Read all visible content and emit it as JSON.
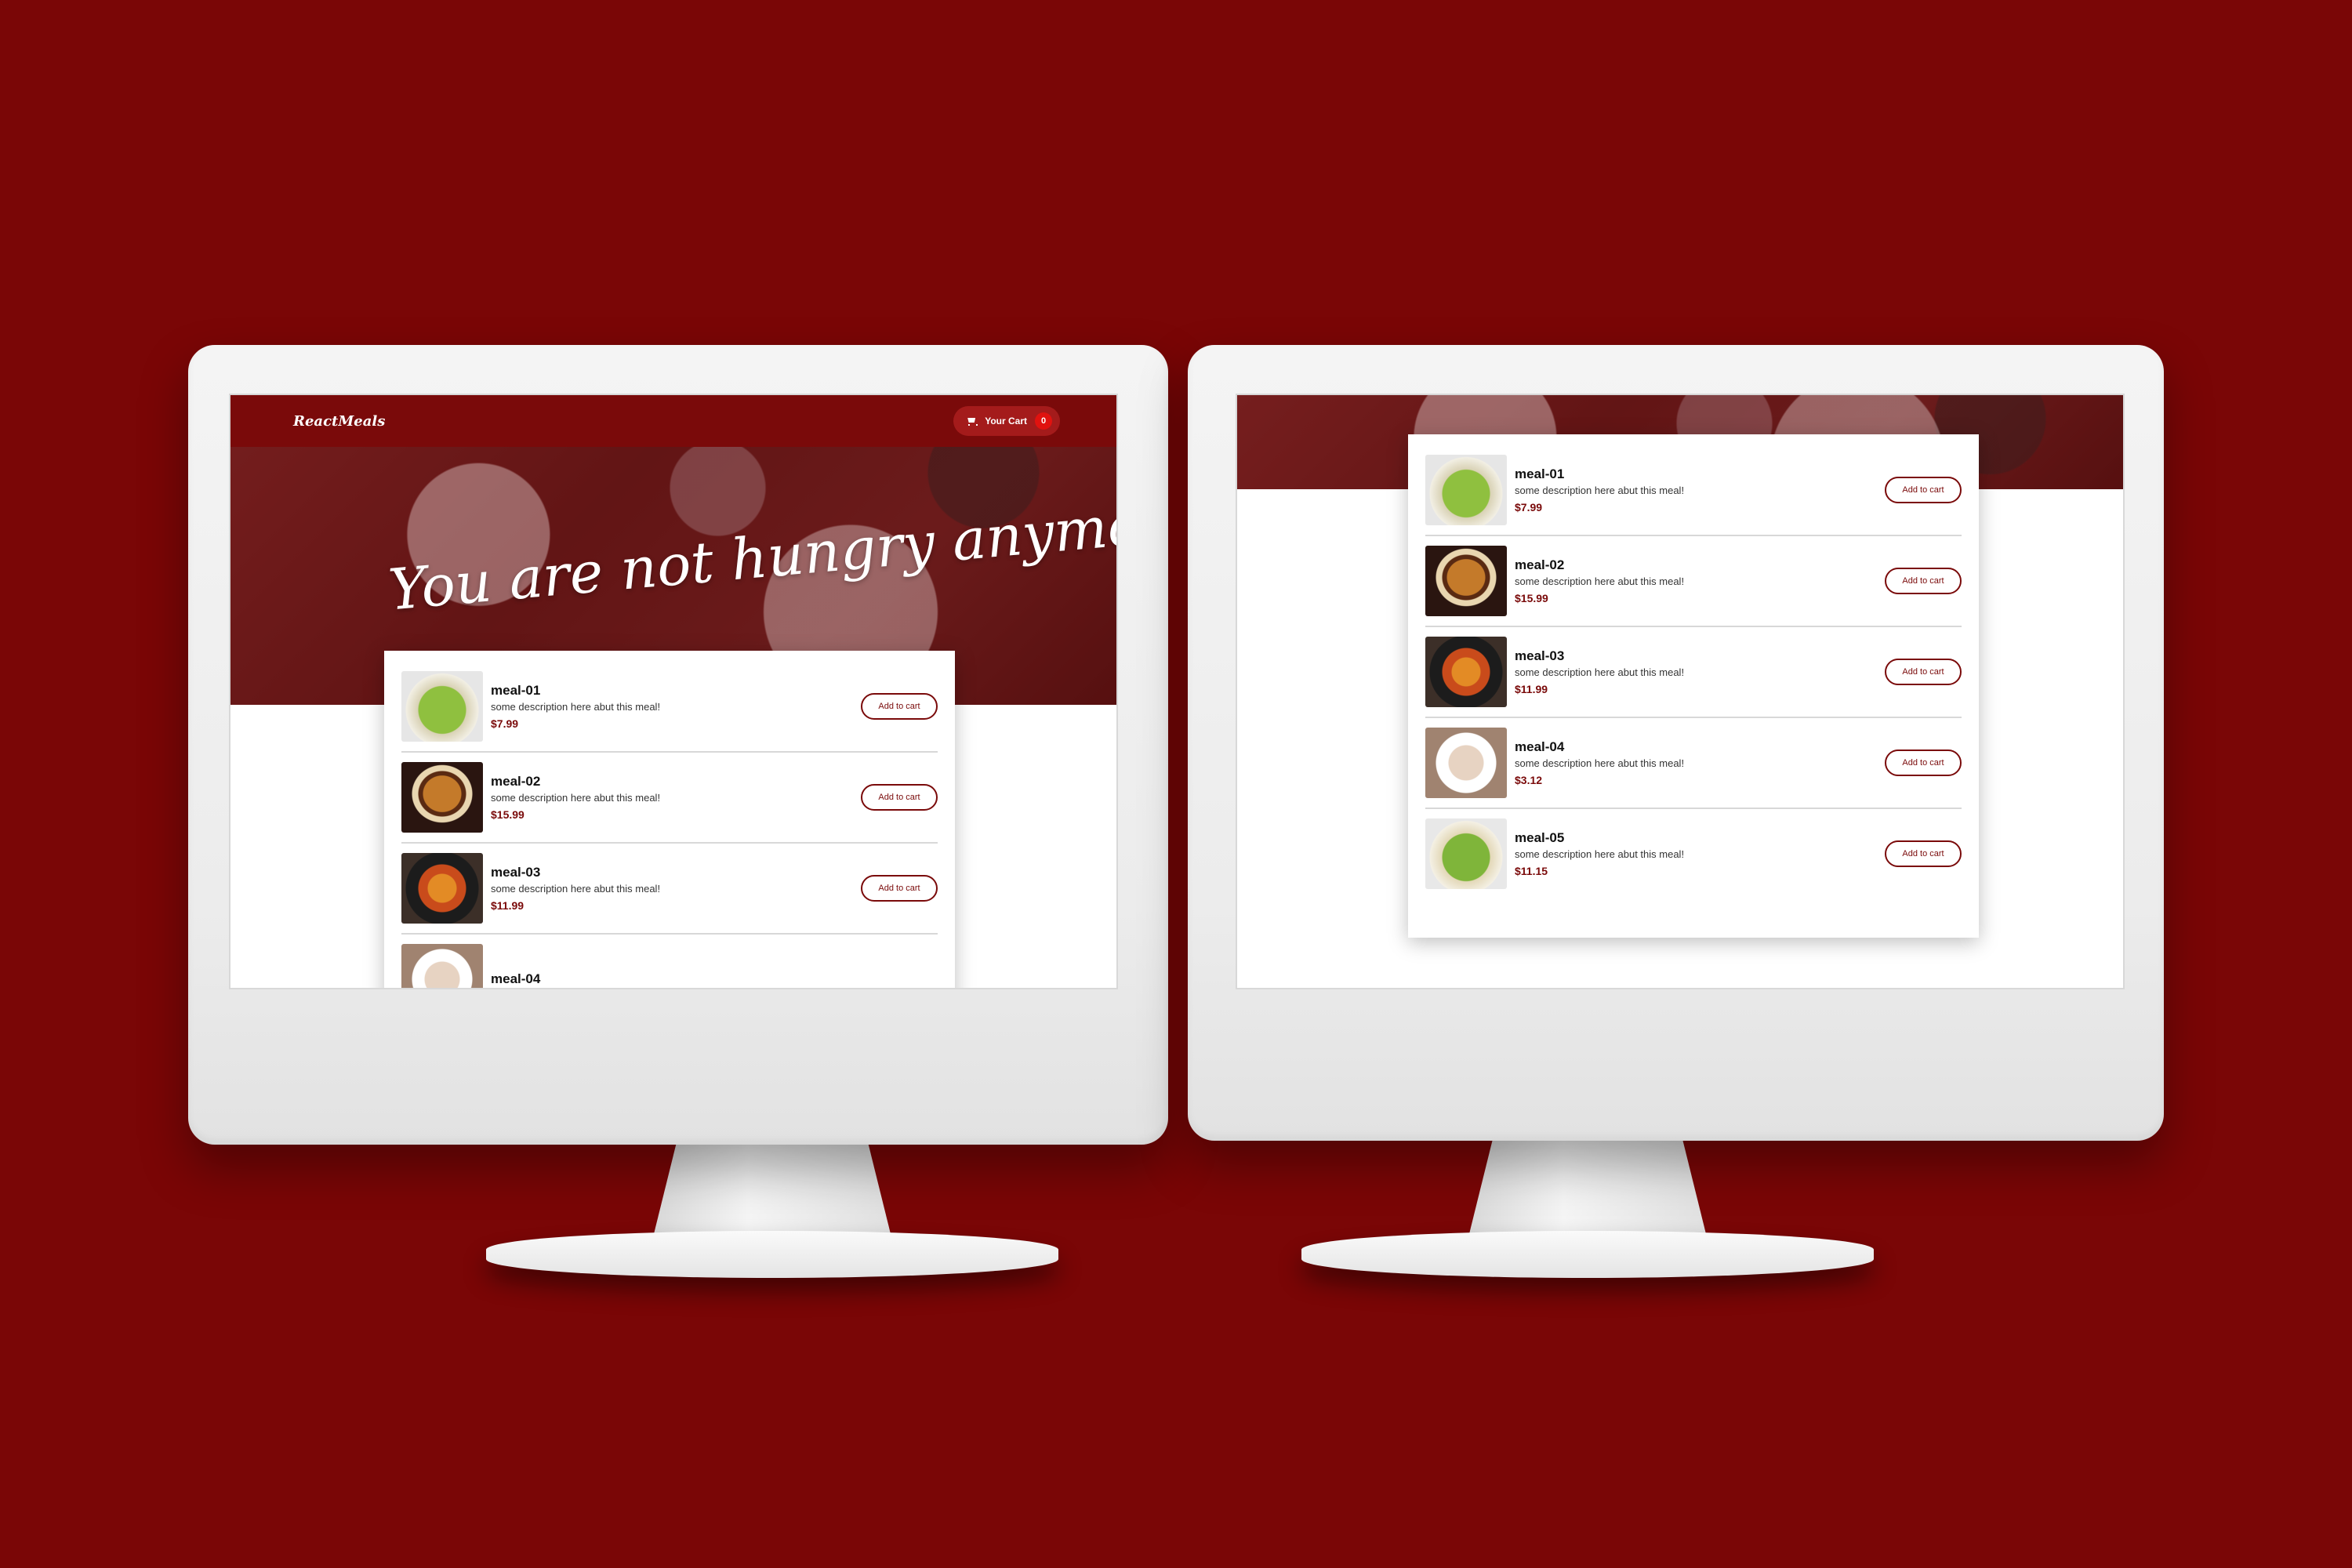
{
  "brand": {
    "logo": "ReactMeals"
  },
  "nav": {
    "cart_label": "Your Cart",
    "cart_count": "0"
  },
  "hero": {
    "title": "You are not hungry anymore!"
  },
  "add_label": "Add to cart",
  "meals": [
    {
      "name": "meal-01",
      "description": "some description here abut this meal!",
      "price": "$7.99"
    },
    {
      "name": "meal-02",
      "description": "some description here abut this meal!",
      "price": "$15.99"
    },
    {
      "name": "meal-03",
      "description": "some description here abut this meal!",
      "price": "$11.99"
    },
    {
      "name": "meal-04",
      "description": "some description here abut this meal!",
      "price": "$3.12"
    },
    {
      "name": "meal-05",
      "description": "some description here abut this meal!",
      "price": "$11.15"
    }
  ],
  "colors": {
    "background": "#7a0606",
    "accent": "#7a0a0a",
    "badge": "#e0120f"
  }
}
